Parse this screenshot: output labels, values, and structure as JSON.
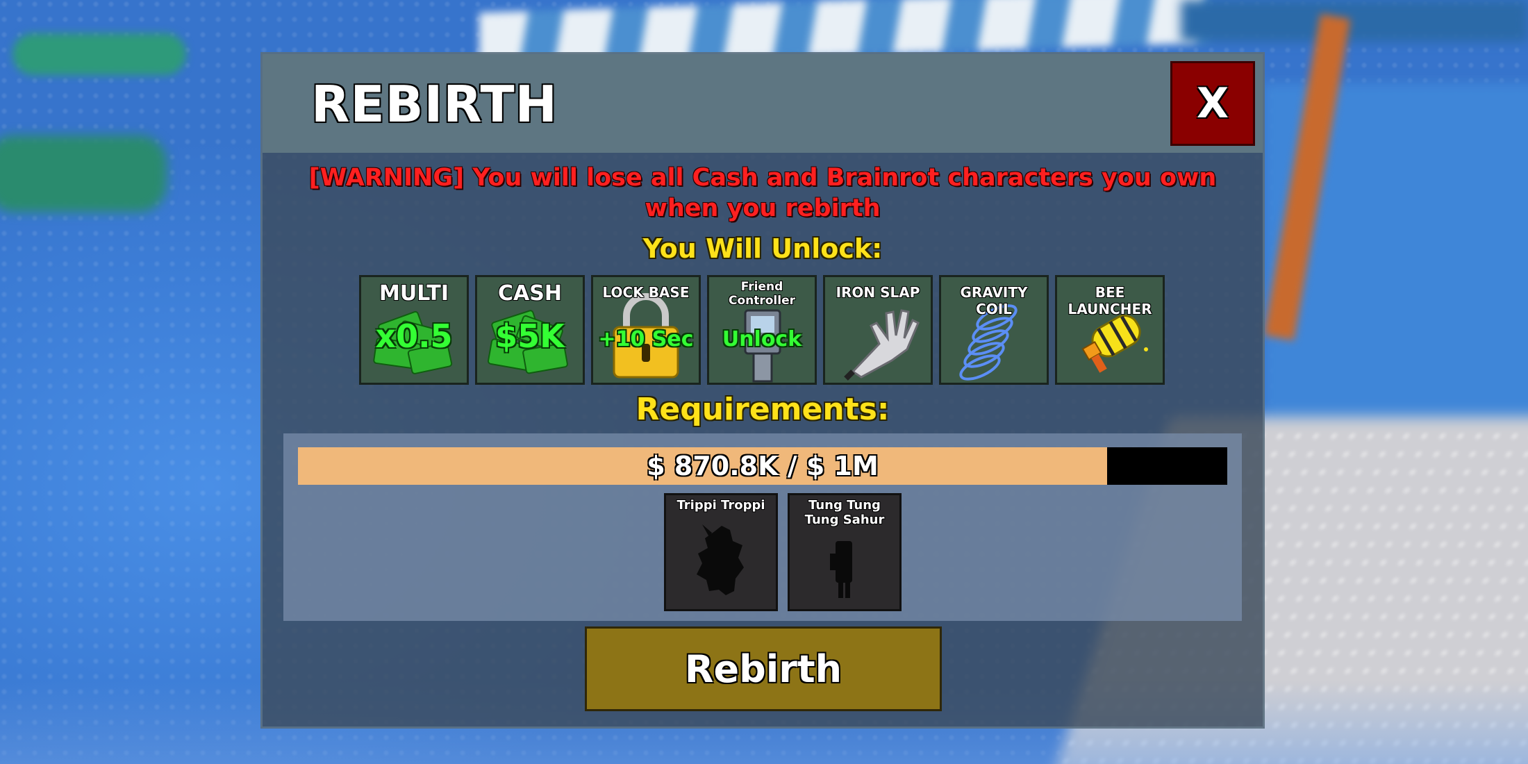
{
  "panel": {
    "title": "REBIRTH",
    "close_label": "X"
  },
  "warning": {
    "line1": "[WARNING] You will lose all Cash and Brainrot characters you own",
    "line2": "when you rebirth"
  },
  "unlock": {
    "title": "You Will Unlock:",
    "items": [
      {
        "label": "MULTI",
        "value": "x0.5",
        "icon": "cash-stack-icon"
      },
      {
        "label": "CASH",
        "value": "$5K",
        "icon": "cash-stack-icon"
      },
      {
        "label": "LOCK BASE",
        "value": "+10 Sec",
        "icon": "padlock-icon"
      },
      {
        "label": "Friend Controller",
        "value": "Unlock",
        "icon": "controller-terminal-icon"
      },
      {
        "label": "IRON SLAP",
        "value": "",
        "icon": "glove-icon"
      },
      {
        "label": "GRAVITY COIL",
        "value": "",
        "icon": "coil-spring-icon"
      },
      {
        "label": "BEE LAUNCHER",
        "value": "",
        "icon": "bee-launcher-icon"
      }
    ]
  },
  "requirements": {
    "title": "Requirements:",
    "progress_text": "$ 870.8K / $ 1M",
    "progress_fraction": 0.8708,
    "characters": [
      {
        "name": "Trippi Troppi",
        "icon": "trippi-troppi-silhouette-icon"
      },
      {
        "name": "Tung Tung Tung Sahur",
        "icon": "tung-tung-sahur-silhouette-icon"
      }
    ]
  },
  "rebirth_button_label": "Rebirth",
  "colors": {
    "warning": "#ff2020",
    "heading": "#ffe21a",
    "unlock_value": "#34ff34",
    "close_button": "#8a0000",
    "rebirth_button": "#8d7416",
    "progress_fill": "#f0b87a"
  }
}
